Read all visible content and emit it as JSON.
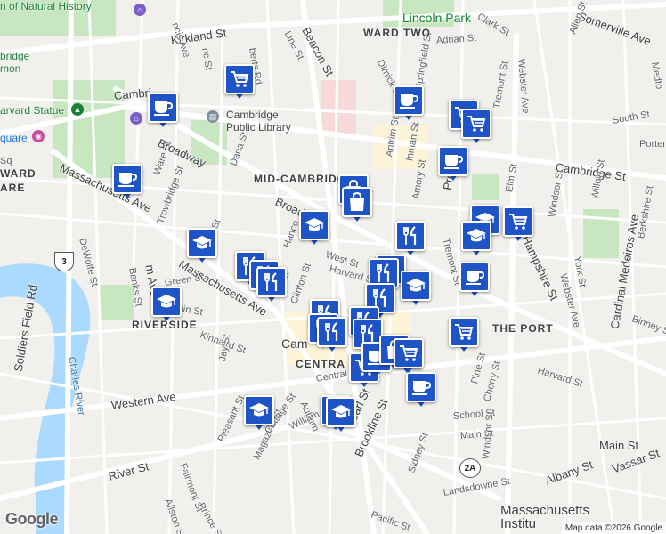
{
  "map": {
    "provider_logo": "Google",
    "attribution": "Map data ©2026 Google",
    "colors": {
      "land": "#f2f0ec",
      "water": "#aadaff",
      "park": "#c8e6c0",
      "road": "#ffffff",
      "marker": "#1f54c6",
      "commercial": "#fdf3d7"
    },
    "labels": {
      "streets": {
        "kirkland_st": "Kirkland St",
        "beacon_st": "Beacon St",
        "line_st": "Line St",
        "dimick_st": "Dimick St",
        "adrian_st": "Adrian St",
        "clark_st": "Clark St",
        "webster_ave_n": "Webster Ave",
        "somerville_ave": "Somerville Ave",
        "allen_st": "Allen St",
        "medford": "Medfo",
        "springfield_st": "Springfield St",
        "tremont_st_n": "Tremont St",
        "south_st": "South St",
        "porter": "Porter",
        "cambridge_st": "Cambridge St",
        "antrim_st": "Antrim St",
        "inman_st": "Inman St",
        "amory_st": "Amory St",
        "prospect": "Pros",
        "elm_st": "Elm St",
        "windsor_st_n": "Windsor St",
        "willow_st": "Willow St",
        "berkshire_st": "Berkshire St",
        "york_st": "York St",
        "cardinal_medeiros_ave": "Cardinal Medeiros Ave",
        "hampshire_st": "Hampshire St",
        "webster_ave_s": "Webster Ave",
        "tremont_st_s": "Tremont St",
        "binney_st": "Binney St",
        "harvard_st_e": "Harvard St",
        "pine_st": "Pine St",
        "cherry_st": "Cherry St",
        "school_st": "School St",
        "main_st": "Main St",
        "main_st_e": "Main St",
        "windsor_st_s": "Windsor St",
        "albany_st": "Albany St",
        "vassar_st": "Vassar St",
        "sidney_st": "Sidney St",
        "landsdowne_st": "Landsdowne St",
        "pacific_st": "Pacific St",
        "brookline_st": "Brookline St",
        "pearl_st": "Pearl St",
        "auburn": "Auburn",
        "william_st": "William St",
        "magazine_st": "Magazine St",
        "cottage_st": "Cottage St",
        "pleasant_st": "Pleasant St",
        "fairmont_st": "Fairmont St",
        "allston_st": "Allston St",
        "prince_st": "Prince St",
        "river_st": "River St",
        "western_ave": "Western Ave",
        "soldiers_field_rd": "Soldiers Field Rd",
        "charles_river": "Charles River",
        "kinnaird_st": "Kinnaird St",
        "jay_st": "Jay St",
        "green_st": "Green St",
        "franklin": "klin St",
        "banks_st": "Banks St",
        "dewolfe_st": "DeWolfe St",
        "massachusetts_ave_w": "Massachusetts Ave",
        "massachusetts_ave_c": "Massachusetts Ave",
        "mass_ave_stub": "m Ave",
        "trowbridge_st": "Trowbridge St",
        "ware_st": "Ware St",
        "broadway_w": "Broadway",
        "broadway_e": "Broad",
        "dana_st": "Dana St",
        "hancock": "Hanco",
        "west_st": "West St",
        "harvard_st": "Harvard St",
        "clinton_st": "Clinton St",
        "irving_st": "ncis Ave",
        "roberts_rd": "berts Rd",
        "fayette": "Cambri",
        "dana_st2": "na St",
        "pe_st": "e St",
        "central": "Central",
        "sq_l": "Sq",
        "nc_st": "nc St"
      },
      "areas": {
        "ward_two": "WARD TWO",
        "mid_cambridge": "MID-CAMBRIDGE",
        "the_port": "THE PORT",
        "riverside": "RIVERSIDE",
        "central": "CENTRA",
        "ward_left": "WARD",
        "are_left": "ARE",
        "cambridge_city": "Cam"
      },
      "pois": {
        "natural_history": "n of Natural History",
        "lincoln_park": "Lincoln Park",
        "cambridge_common": "bridge\nmon",
        "harvard_statue": "arvard Statue",
        "harvard_square": "quare",
        "cambridge_public_library": "Cambridge\nPublic Library",
        "mit": "Massachusetts\nInstitu"
      },
      "shields": {
        "us_3": "3",
        "ma_2a": "2A"
      }
    },
    "markers": [
      {
        "type": "grocery",
        "icon": "shopping-cart-icon"
      },
      {
        "type": "cafe",
        "icon": "coffee-cup-icon"
      },
      {
        "type": "grocery",
        "icon": "shopping-cart-icon"
      },
      {
        "type": "grocery",
        "icon": "shopping-cart-icon"
      },
      {
        "type": "cafe",
        "icon": "coffee-cup-icon"
      },
      {
        "type": "cafe",
        "icon": "coffee-cup-icon"
      },
      {
        "type": "cafe",
        "icon": "coffee-cup-icon"
      },
      {
        "type": "shopping",
        "icon": "shopping-bag-icon"
      },
      {
        "type": "shopping",
        "icon": "shopping-bag-icon"
      },
      {
        "type": "school",
        "icon": "graduation-cap-icon"
      },
      {
        "type": "school",
        "icon": "graduation-cap-icon"
      },
      {
        "type": "grocery",
        "icon": "shopping-cart-icon"
      },
      {
        "type": "school",
        "icon": "graduation-cap-icon"
      },
      {
        "type": "school",
        "icon": "graduation-cap-icon"
      },
      {
        "type": "restaurant",
        "icon": "fork-knife-icon"
      },
      {
        "type": "shopping",
        "icon": "shopping-bag-icon"
      },
      {
        "type": "restaurant",
        "icon": "fork-knife-icon"
      },
      {
        "type": "restaurant",
        "icon": "fork-knife-icon"
      },
      {
        "type": "restaurant",
        "icon": "fork-knife-icon"
      },
      {
        "type": "cafe",
        "icon": "coffee-cup-icon"
      },
      {
        "type": "school",
        "icon": "graduation-cap-icon"
      },
      {
        "type": "restaurant",
        "icon": "fork-knife-icon"
      },
      {
        "type": "restaurant",
        "icon": "fork-knife-icon"
      },
      {
        "type": "restaurant",
        "icon": "fork-knife-icon"
      },
      {
        "type": "grocery",
        "icon": "shopping-cart-icon"
      },
      {
        "type": "school",
        "icon": "graduation-cap-icon"
      },
      {
        "type": "restaurant",
        "icon": "fork-knife-icon"
      },
      {
        "type": "restaurant",
        "icon": "fork-knife-icon"
      },
      {
        "type": "restaurant",
        "icon": "fork-knife-icon"
      },
      {
        "type": "restaurant",
        "icon": "fork-knife-icon"
      },
      {
        "type": "cafe",
        "icon": "coffee-cup-icon"
      },
      {
        "type": "grocery",
        "icon": "shopping-cart-icon"
      },
      {
        "type": "grocery",
        "icon": "shopping-cart-icon"
      },
      {
        "type": "cafe",
        "icon": "coffee-cup-icon"
      },
      {
        "type": "school",
        "icon": "graduation-cap-icon"
      },
      {
        "type": "school",
        "icon": "graduation-cap-icon"
      },
      {
        "type": "school",
        "icon": "graduation-cap-icon"
      },
      {
        "type": "shopping",
        "icon": "shopping-bag-icon"
      },
      {
        "type": "grocery",
        "icon": "shopping-cart-icon"
      }
    ]
  }
}
